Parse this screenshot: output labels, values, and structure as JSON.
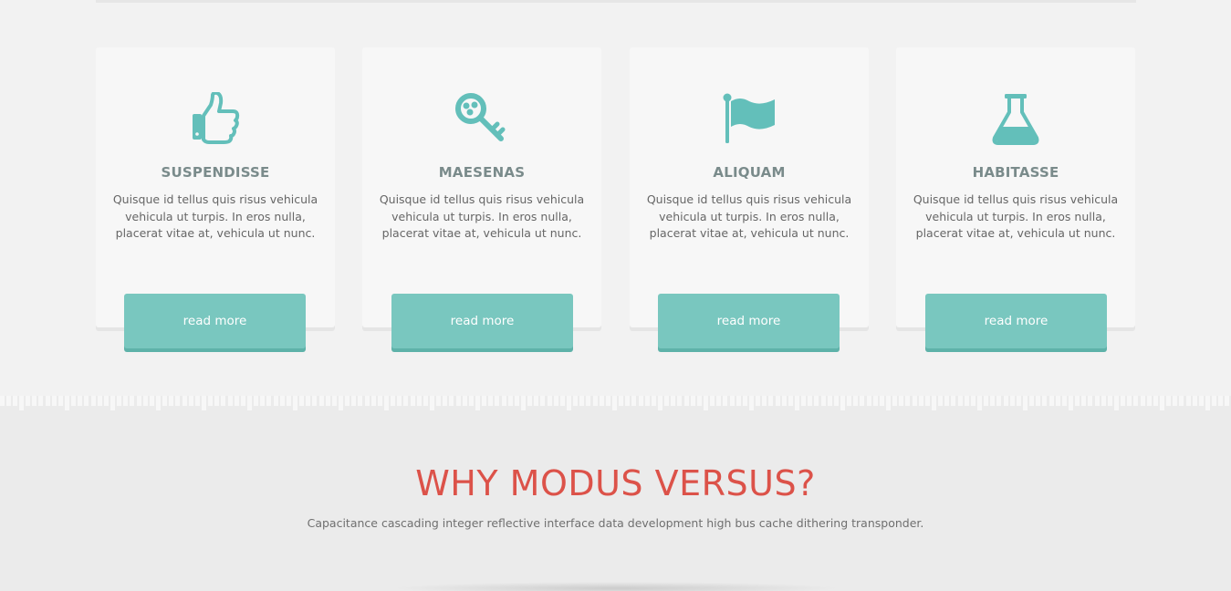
{
  "features": [
    {
      "icon": "thumbs-up-icon",
      "title": "SUSPENDISSE",
      "text": "Quisque id tellus quis risus vehicula vehicula ut turpis. In eros nulla, placerat vitae at, vehicula ut nunc.",
      "button": "read more"
    },
    {
      "icon": "key-icon",
      "title": "MAESENAS",
      "text": "Quisque id tellus quis risus vehicula vehicula ut turpis. In eros nulla, placerat vitae at, vehicula ut nunc.",
      "button": "read more"
    },
    {
      "icon": "flag-icon",
      "title": "ALIQUAM",
      "text": "Quisque id tellus quis risus vehicula vehicula ut turpis. In eros nulla, placerat vitae at, vehicula ut nunc.",
      "button": "read more"
    },
    {
      "icon": "flask-icon",
      "title": "HABITASSE",
      "text": "Quisque id tellus quis risus vehicula vehicula ut turpis. In eros nulla, placerat vitae at, vehicula ut nunc.",
      "button": "read more"
    }
  ],
  "why": {
    "title": "WHY MODUS VERSUS?",
    "subtitle": "Capacitance cascading integer reflective interface data development high bus cache dithering transponder."
  },
  "colors": {
    "accent_teal": "#63bfba",
    "button_teal": "#79c7bf",
    "heading_red": "#dc5249",
    "card_title_gray": "#7a8b8b"
  }
}
